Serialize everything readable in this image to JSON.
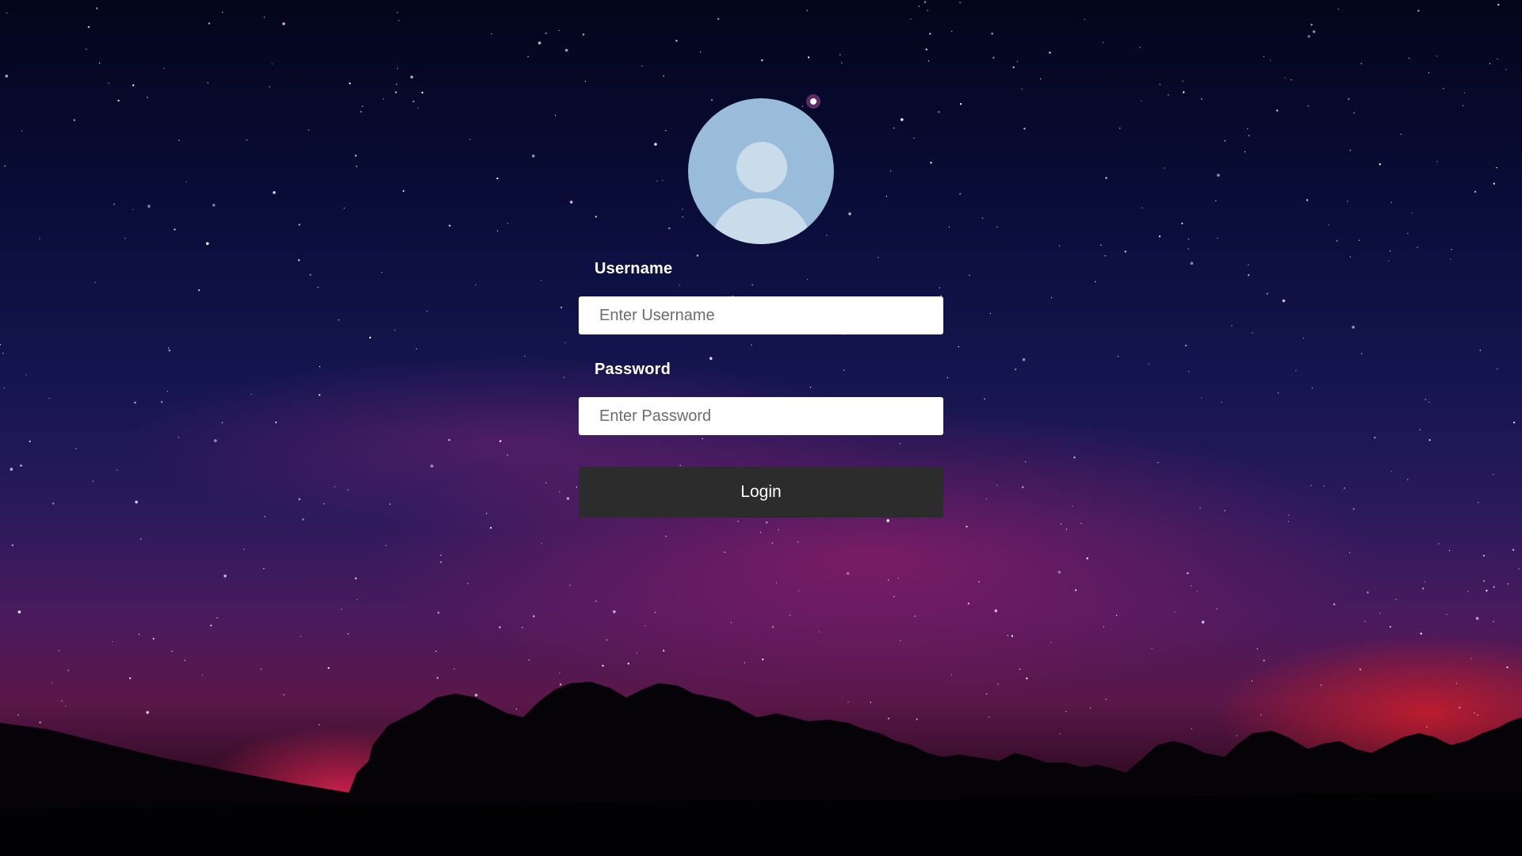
{
  "background": {
    "description_icon": "starry-night-sky-icon",
    "sky_colors": [
      "#03061a",
      "#151650",
      "#4a1a5e",
      "#5b1749"
    ],
    "treeline_color": "#050308"
  },
  "login": {
    "avatar_icon": "user-avatar-icon",
    "username_label": "Username",
    "username_placeholder": "Enter Username",
    "username_value": "",
    "password_label": "Password",
    "password_placeholder": "Enter Password",
    "password_value": "",
    "submit_label": "Login",
    "colors": {
      "avatar_bg": "#98bcd9",
      "avatar_fg": "#c9dcea",
      "button_bg": "#2c2c2c",
      "label_text": "#ffffff"
    }
  }
}
